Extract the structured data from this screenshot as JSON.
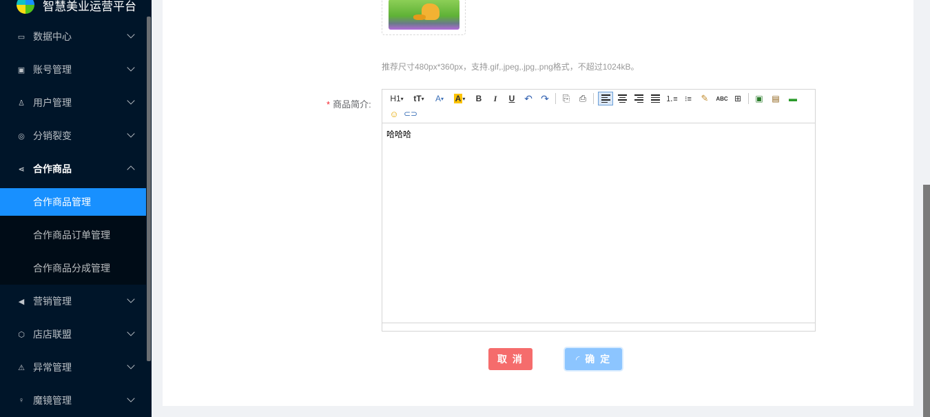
{
  "app": {
    "title": "智慧美业运营平台"
  },
  "sidebar": {
    "items": [
      {
        "label": "数据中心",
        "icon": "monitor-icon"
      },
      {
        "label": "账号管理",
        "icon": "id-card-icon"
      },
      {
        "label": "用户管理",
        "icon": "user-icon"
      },
      {
        "label": "分销裂变",
        "icon": "distribution-icon"
      },
      {
        "label": "合作商品",
        "icon": "share-icon",
        "expanded": true,
        "children": [
          {
            "label": "合作商品管理",
            "active": true
          },
          {
            "label": "合作商品订单管理"
          },
          {
            "label": "合作商品分成管理"
          }
        ]
      },
      {
        "label": "营销管理",
        "icon": "megaphone-icon"
      },
      {
        "label": "店店联盟",
        "icon": "cube-icon"
      },
      {
        "label": "异常管理",
        "icon": "warning-icon"
      },
      {
        "label": "魔镜管理",
        "icon": "mirror-icon"
      }
    ]
  },
  "form": {
    "image_hint": "推荐尺寸480px*360px，支持.gif,.jpeg,.jpg,.png格式，不超过1024kB。",
    "intro_label": "商品简介:",
    "required_mark": "*",
    "editor": {
      "content": "哈哈哈",
      "toolbar": [
        "H1",
        "tT",
        "A",
        "A",
        "B",
        "I",
        "U",
        "undo-icon",
        "redo-icon",
        "preview-icon",
        "print-icon",
        "align-left-icon",
        "align-center-icon",
        "align-right-icon",
        "align-justify-icon",
        "ordered-list-icon",
        "unordered-list-icon",
        "format-painter-icon",
        "ABC",
        "table-icon",
        "image-icon",
        "image-upload-icon",
        "horizontal-rule-icon",
        "emoji-icon",
        "link-icon"
      ]
    },
    "buttons": {
      "cancel": "取 消",
      "confirm": "确 定"
    }
  },
  "colors": {
    "sidebar": "#001529",
    "active": "#1890ff",
    "cancel": "#f56c6c",
    "confirm": "#8cc5ff"
  }
}
